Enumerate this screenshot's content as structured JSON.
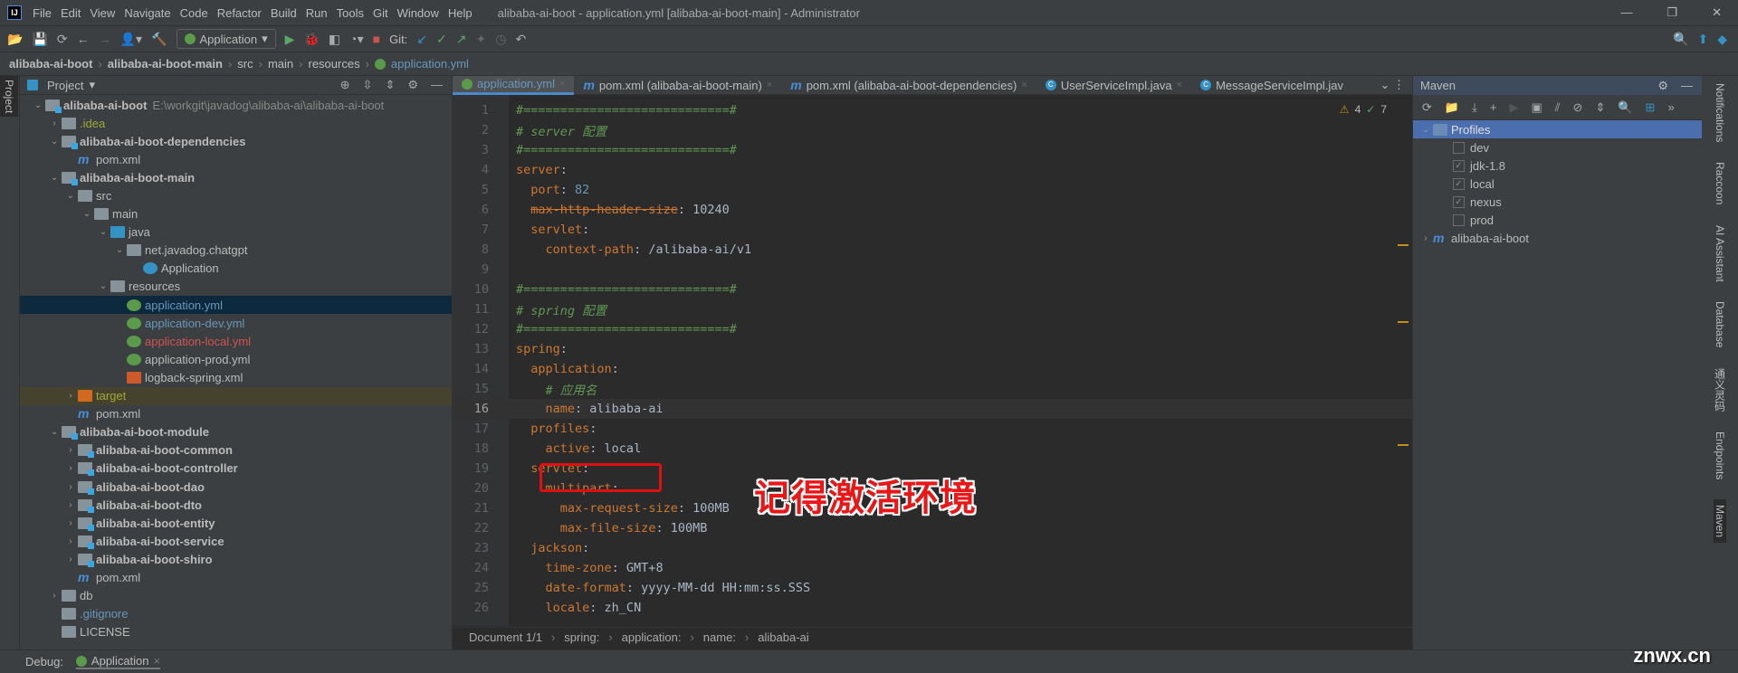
{
  "window": {
    "title": "alibaba-ai-boot - application.yml [alibaba-ai-boot-main] - Administrator",
    "logo": "IJ",
    "menu": [
      "File",
      "Edit",
      "View",
      "Navigate",
      "Code",
      "Refactor",
      "Build",
      "Run",
      "Tools",
      "Git",
      "Window",
      "Help"
    ]
  },
  "toolbar": {
    "run_config": "Application",
    "git_label": "Git:"
  },
  "breadcrumb": [
    "alibaba-ai-boot",
    "alibaba-ai-boot-main",
    "src",
    "main",
    "resources",
    "application.yml"
  ],
  "left_stripe": {
    "label": "Project"
  },
  "project": {
    "title": "Project",
    "tree": [
      {
        "label": "alibaba-ai-boot",
        "path": "E:\\workgit\\javadog\\alibaba-ai\\alibaba-ai-boot",
        "depth": 0,
        "icon": "module-folder",
        "bold": true,
        "open": true
      },
      {
        "label": ".idea",
        "depth": 1,
        "icon": "folder",
        "color": "#a2a83a",
        "closed": true
      },
      {
        "label": "alibaba-ai-boot-dependencies",
        "depth": 1,
        "icon": "module-folder",
        "bold": true,
        "open": true
      },
      {
        "label": "pom.xml",
        "depth": 2,
        "icon": "maven"
      },
      {
        "label": "alibaba-ai-boot-main",
        "depth": 1,
        "icon": "module-folder",
        "bold": true,
        "open": true
      },
      {
        "label": "src",
        "depth": 2,
        "icon": "folder",
        "open": true
      },
      {
        "label": "main",
        "depth": 3,
        "icon": "folder",
        "open": true
      },
      {
        "label": "java",
        "depth": 4,
        "icon": "source-folder",
        "open": true
      },
      {
        "label": "net.javadog.chatgpt",
        "depth": 5,
        "icon": "package",
        "open": true
      },
      {
        "label": "Application",
        "depth": 6,
        "icon": "spring-class"
      },
      {
        "label": "resources",
        "depth": 4,
        "icon": "resources-folder",
        "open": true
      },
      {
        "label": "application.yml",
        "depth": 5,
        "icon": "spring-yml",
        "color": "#6897bb",
        "selected": true
      },
      {
        "label": "application-dev.yml",
        "depth": 5,
        "icon": "spring-yml",
        "color": "#6897bb"
      },
      {
        "label": "application-local.yml",
        "depth": 5,
        "icon": "spring-yml",
        "color": "#d25252"
      },
      {
        "label": "application-prod.yml",
        "depth": 5,
        "icon": "spring-yml"
      },
      {
        "label": "logback-spring.xml",
        "depth": 5,
        "icon": "xml-file"
      },
      {
        "label": "target",
        "depth": 2,
        "icon": "excluded-folder",
        "color": "#a2a83a",
        "closed": true,
        "target": true
      },
      {
        "label": "pom.xml",
        "depth": 2,
        "icon": "maven"
      },
      {
        "label": "alibaba-ai-boot-module",
        "depth": 1,
        "icon": "module-folder",
        "bold": true,
        "open": true
      },
      {
        "label": "alibaba-ai-boot-common",
        "depth": 2,
        "icon": "module-folder",
        "bold": true,
        "closed": true
      },
      {
        "label": "alibaba-ai-boot-controller",
        "depth": 2,
        "icon": "module-folder",
        "bold": true,
        "closed": true
      },
      {
        "label": "alibaba-ai-boot-dao",
        "depth": 2,
        "icon": "module-folder",
        "bold": true,
        "closed": true
      },
      {
        "label": "alibaba-ai-boot-dto",
        "depth": 2,
        "icon": "module-folder",
        "bold": true,
        "closed": true
      },
      {
        "label": "alibaba-ai-boot-entity",
        "depth": 2,
        "icon": "module-folder",
        "bold": true,
        "closed": true
      },
      {
        "label": "alibaba-ai-boot-service",
        "depth": 2,
        "icon": "module-folder",
        "bold": true,
        "closed": true
      },
      {
        "label": "alibaba-ai-boot-shiro",
        "depth": 2,
        "icon": "module-folder",
        "bold": true,
        "closed": true
      },
      {
        "label": "pom.xml",
        "depth": 2,
        "icon": "maven"
      },
      {
        "label": "db",
        "depth": 1,
        "icon": "folder",
        "closed": true
      },
      {
        "label": ".gitignore",
        "depth": 1,
        "icon": "ignore-file",
        "color": "#6897bb"
      },
      {
        "label": "LICENSE",
        "depth": 1,
        "icon": "text-file"
      }
    ]
  },
  "editor": {
    "tabs": [
      {
        "label": "application.yml",
        "icon": "spring-yml",
        "active": true
      },
      {
        "label": "pom.xml (alibaba-ai-boot-main)",
        "icon": "maven"
      },
      {
        "label": "pom.xml (alibaba-ai-boot-dependencies)",
        "icon": "maven"
      },
      {
        "label": "UserServiceImpl.java",
        "icon": "class"
      },
      {
        "label": "MessageServiceImpl.jav",
        "icon": "class"
      }
    ],
    "warnings": "4",
    "weak_warnings": "7",
    "current_line": 16,
    "lines": [
      [
        [
          "c",
          "#============================#"
        ]
      ],
      [
        [
          "c",
          "# server 配置"
        ]
      ],
      [
        [
          "c",
          "#============================#"
        ]
      ],
      [
        [
          "k",
          "server"
        ],
        [
          "v",
          ":"
        ]
      ],
      [
        [
          "v",
          "  "
        ],
        [
          "k",
          "port"
        ],
        [
          "v",
          ": "
        ],
        [
          "n",
          "82"
        ]
      ],
      [
        [
          "v",
          "  "
        ],
        [
          "ks",
          "max-http-header-size"
        ],
        [
          "v",
          ": 10240"
        ]
      ],
      [
        [
          "v",
          "  "
        ],
        [
          "k",
          "servlet"
        ],
        [
          "v",
          ":"
        ]
      ],
      [
        [
          "v",
          "    "
        ],
        [
          "k",
          "context-path"
        ],
        [
          "v",
          ": /alibaba-ai/v1"
        ]
      ],
      [],
      [
        [
          "c",
          "#============================#"
        ]
      ],
      [
        [
          "c",
          "# spring 配置"
        ]
      ],
      [
        [
          "c",
          "#============================#"
        ]
      ],
      [
        [
          "k",
          "spring"
        ],
        [
          "v",
          ":"
        ]
      ],
      [
        [
          "v",
          "  "
        ],
        [
          "k",
          "application"
        ],
        [
          "v",
          ":"
        ]
      ],
      [
        [
          "v",
          "    "
        ],
        [
          "c",
          "# 应用名"
        ]
      ],
      [
        [
          "v",
          "    "
        ],
        [
          "k",
          "name"
        ],
        [
          "v",
          ": alibaba-ai"
        ]
      ],
      [
        [
          "v",
          "  "
        ],
        [
          "k",
          "profiles"
        ],
        [
          "v",
          ":"
        ]
      ],
      [
        [
          "v",
          "    "
        ],
        [
          "k",
          "active"
        ],
        [
          "v",
          ": local"
        ]
      ],
      [
        [
          "v",
          "  "
        ],
        [
          "k",
          "servlet"
        ],
        [
          "v",
          ":"
        ]
      ],
      [
        [
          "v",
          "    "
        ],
        [
          "k",
          "multipart"
        ],
        [
          "v",
          ":"
        ]
      ],
      [
        [
          "v",
          "      "
        ],
        [
          "k",
          "max-request-size"
        ],
        [
          "v",
          ": 100MB"
        ]
      ],
      [
        [
          "v",
          "      "
        ],
        [
          "k",
          "max-file-size"
        ],
        [
          "v",
          ": 100MB"
        ]
      ],
      [
        [
          "v",
          "  "
        ],
        [
          "k",
          "jackson"
        ],
        [
          "v",
          ":"
        ]
      ],
      [
        [
          "v",
          "    "
        ],
        [
          "k",
          "time-zone"
        ],
        [
          "v",
          ": GMT+8"
        ]
      ],
      [
        [
          "v",
          "    "
        ],
        [
          "k",
          "date-format"
        ],
        [
          "v",
          ": yyyy-MM-dd HH:mm:ss.SSS"
        ]
      ],
      [
        [
          "v",
          "    "
        ],
        [
          "k",
          "locale"
        ],
        [
          "v",
          ": zh_CN"
        ]
      ]
    ],
    "breadcrumb": [
      "Document 1/1",
      "spring:",
      "application:",
      "name:",
      "alibaba-ai"
    ]
  },
  "annotation": {
    "text": "记得激活环境",
    "color": "#e81818"
  },
  "maven": {
    "title": "Maven",
    "profiles_label": "Profiles",
    "profiles": [
      {
        "label": "dev",
        "checked": false
      },
      {
        "label": "jdk-1.8",
        "checked": true
      },
      {
        "label": "local",
        "checked": true
      },
      {
        "label": "nexus",
        "checked": true
      },
      {
        "label": "prod",
        "checked": false
      }
    ],
    "project": "alibaba-ai-boot"
  },
  "right_stripe": [
    "Notifications",
    "Raccoon",
    "AI Assistant",
    "Database",
    "通义灵码",
    "Endpoints",
    "Maven"
  ],
  "debug": {
    "label": "Debug:",
    "tab": "Application"
  },
  "watermark": "znwx.cn"
}
